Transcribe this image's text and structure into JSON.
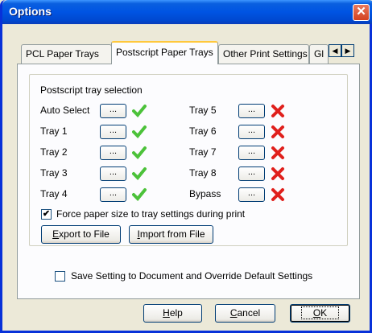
{
  "window": {
    "title": "Options",
    "close": "✕"
  },
  "tabs": [
    {
      "label": "PCL Paper Trays"
    },
    {
      "label": "Postscript Paper Trays"
    },
    {
      "label": "Other Print Settings"
    },
    {
      "label": "Gl"
    }
  ],
  "tab_scroll": {
    "left": "◀",
    "right": "▶"
  },
  "group": {
    "label": "Postscript tray selection"
  },
  "trays_left": [
    {
      "name": "Auto Select",
      "button": "...",
      "status": "enabled"
    },
    {
      "name": "Tray 1",
      "button": "...",
      "status": "enabled"
    },
    {
      "name": "Tray 2",
      "button": "...",
      "status": "enabled"
    },
    {
      "name": "Tray 3",
      "button": "...",
      "status": "enabled"
    },
    {
      "name": "Tray 4",
      "button": "...",
      "status": "enabled"
    }
  ],
  "trays_right": [
    {
      "name": "Tray 5",
      "button": "...",
      "status": "disabled"
    },
    {
      "name": "Tray 6",
      "button": "...",
      "status": "disabled"
    },
    {
      "name": "Tray 7",
      "button": "...",
      "status": "disabled"
    },
    {
      "name": "Tray 8",
      "button": "...",
      "status": "disabled"
    },
    {
      "name": "Bypass",
      "button": "...",
      "status": "disabled"
    }
  ],
  "force_paper": {
    "label": "Force paper size to tray settings during print",
    "checked": true,
    "mark": "✔"
  },
  "export_button": {
    "label_first": "E",
    "label_rest": "xport to File"
  },
  "import_button": {
    "label_first": "I",
    "label_rest": "mport from File"
  },
  "save_setting": {
    "label": "Save Setting to Document and Override Default Settings",
    "checked": false
  },
  "footer": {
    "help": {
      "first": "H",
      "rest": "elp"
    },
    "cancel": {
      "first": "C",
      "rest": "ancel"
    },
    "ok": {
      "first": "O",
      "rest": "K"
    }
  },
  "colors": {
    "titlebar": "#0054e3",
    "check": "#4cc23a",
    "cross": "#e0201c"
  }
}
